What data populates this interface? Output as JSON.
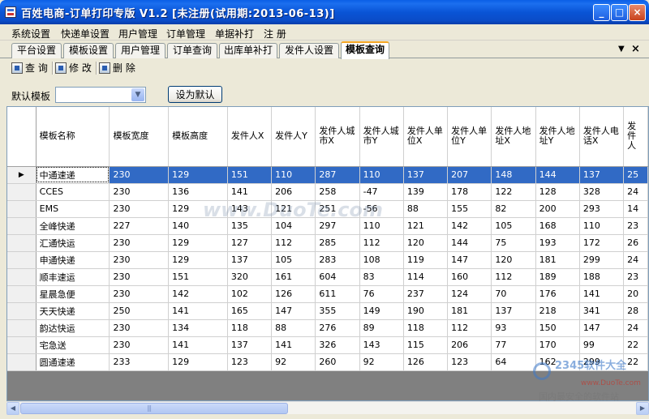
{
  "window": {
    "title": "百姓电商-订单打印专版 V1.2 [未注册(试用期:2013-06-13)]",
    "min_label": "_",
    "max_label": "□",
    "close_label": "×"
  },
  "menu": [
    "系统设置",
    "快递单设置",
    "用户管理",
    "订单管理",
    "单据补打",
    "注 册"
  ],
  "tabs": [
    {
      "label": "平台设置",
      "active": false
    },
    {
      "label": "模板设置",
      "active": false
    },
    {
      "label": "用户管理",
      "active": false
    },
    {
      "label": "订单查询",
      "active": false
    },
    {
      "label": "出库单补打",
      "active": false
    },
    {
      "label": "发件人设置",
      "active": false
    },
    {
      "label": "模板查询",
      "active": true
    }
  ],
  "tab_controls": {
    "menu_glyph": "▼",
    "close_glyph": "×"
  },
  "toolbar": {
    "query": "查 询",
    "edit": "修 改",
    "delete": "删 除"
  },
  "default_template": {
    "label": "默认模板",
    "value": "",
    "button": "设为默认"
  },
  "grid": {
    "columns": [
      "模板名称",
      "模板宽度",
      "模板高度",
      "发件人X",
      "发件人Y",
      "发件人城市X",
      "发件人城市Y",
      "发件人单位X",
      "发件人单位Y",
      "发件人地址X",
      "发件人地址Y",
      "发件人电话X",
      "发件人"
    ],
    "selected_row": 0,
    "current_row_marker": "▶",
    "rows": [
      [
        "中通速递",
        "230",
        "129",
        "151",
        "110",
        "287",
        "110",
        "137",
        "207",
        "148",
        "144",
        "137",
        "25"
      ],
      [
        "CCES",
        "230",
        "136",
        "141",
        "206",
        "258",
        "-47",
        "139",
        "178",
        "122",
        "128",
        "328",
        "24"
      ],
      [
        "EMS",
        "230",
        "129",
        "143",
        "121",
        "251",
        "-56",
        "88",
        "155",
        "82",
        "200",
        "293",
        "14"
      ],
      [
        "全峰快递",
        "227",
        "140",
        "135",
        "104",
        "297",
        "110",
        "121",
        "142",
        "105",
        "168",
        "110",
        "23"
      ],
      [
        "汇通快运",
        "230",
        "129",
        "127",
        "112",
        "285",
        "112",
        "120",
        "144",
        "75",
        "193",
        "172",
        "26"
      ],
      [
        "申通快递",
        "230",
        "129",
        "137",
        "105",
        "283",
        "108",
        "119",
        "147",
        "120",
        "181",
        "299",
        "24"
      ],
      [
        "顺丰速运",
        "230",
        "151",
        "320",
        "161",
        "604",
        "83",
        "114",
        "160",
        "112",
        "189",
        "188",
        "23"
      ],
      [
        "星晨急便",
        "230",
        "142",
        "102",
        "126",
        "611",
        "76",
        "237",
        "124",
        "70",
        "176",
        "141",
        "20"
      ],
      [
        "天天快递",
        "250",
        "141",
        "165",
        "147",
        "355",
        "149",
        "190",
        "181",
        "137",
        "218",
        "341",
        "28"
      ],
      [
        "韵达快运",
        "230",
        "134",
        "118",
        "88",
        "276",
        "89",
        "118",
        "112",
        "93",
        "150",
        "147",
        "24"
      ],
      [
        "宅急送",
        "230",
        "141",
        "137",
        "141",
        "326",
        "143",
        "115",
        "206",
        "77",
        "170",
        "99",
        "22"
      ],
      [
        "圆通速递",
        "233",
        "129",
        "123",
        "92",
        "260",
        "92",
        "126",
        "123",
        "64",
        "162",
        "299",
        "22"
      ]
    ]
  },
  "scrollbar": {
    "left": "◀",
    "right": "▶"
  },
  "watermarks": {
    "center": "www.DuoTe.com",
    "logo": "2345软件大全",
    "logo_url": "www.DuoTe.com",
    "slogan": "国内最安全的软件站"
  }
}
